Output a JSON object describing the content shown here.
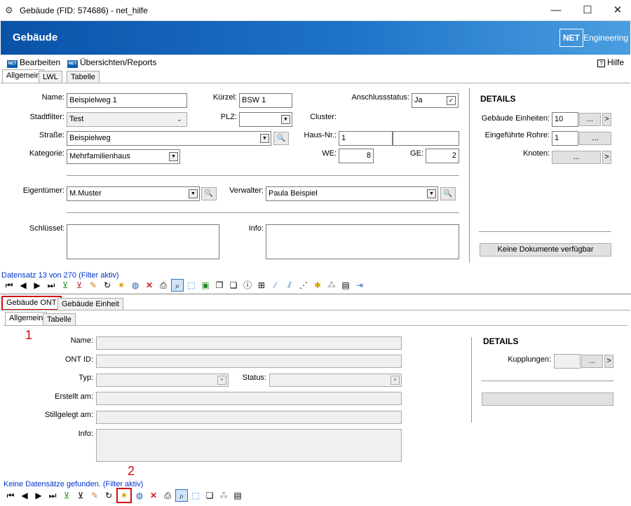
{
  "window": {
    "title": "Gebäude (FID: 574686) - net_hilfe",
    "minimize": "—",
    "maximize": "☐",
    "close": "✕"
  },
  "banner": {
    "title": "Gebäude",
    "logo": "NET",
    "company": "Engineering"
  },
  "menu": {
    "edit": "Bearbeiten",
    "reports": "Übersichten/Reports",
    "help": "Hilfe"
  },
  "tabs": {
    "allgemein": "Allgemein",
    "lwl": "LWL",
    "tabelle": "Tabelle"
  },
  "form": {
    "name_label": "Name:",
    "name": "Beispielweg 1",
    "kuerzel_label": "Kürzel:",
    "kuerzel": "BSW 1",
    "anschluss_label": "Anschlussstatus:",
    "anschluss": "Ja",
    "stadtfilter_label": "Stadtfilter:",
    "stadtfilter": "Test",
    "plz_label": "PLZ:",
    "plz": "",
    "cluster_label": "Cluster:",
    "strasse_label": "Straße:",
    "strasse": "Beispielweg",
    "hausnr_label": "Haus-Nr.:",
    "hausnr": "1",
    "hausnr_zusatz": "",
    "kategorie_label": "Kategorie:",
    "kategorie": "Mehrfamilienhaus",
    "we_label": "WE:",
    "we": "8",
    "ge_label": "GE:",
    "ge": "2",
    "eigentuemer_label": "Eigentümer:",
    "eigentuemer": "M.Muster",
    "verwalter_label": "Verwalter:",
    "verwalter": "Paula Beispiel",
    "schluessel_label": "Schlüssel:",
    "info_label": "Info:"
  },
  "details": {
    "title": "DETAILS",
    "einheiten_label": "Gebäude Einheiten:",
    "einheiten": "10",
    "rohre_label": "Eingeführte Rohre:",
    "rohre": "1",
    "knoten_label": "Knoten:",
    "ellipsis": "...",
    "arrow": ">",
    "no_docs": "Keine Dokumente verfügbar"
  },
  "status_top": "Datensatz 13 von 270 (Filter aktiv)",
  "subtabs": {
    "ont": "Gebäude ONT",
    "einheit": "Gebäude Einheit",
    "allgemein": "Allgemein",
    "tabelle": "Tabelle"
  },
  "ont": {
    "name_label": "Name:",
    "ontid_label": "ONT ID:",
    "typ_label": "Typ:",
    "status_label": "Status:",
    "erstellt_label": "Erstellt am:",
    "stillgelegt_label": "Stillgelegt am:",
    "info_label": "Info:"
  },
  "ont_details": {
    "title": "DETAILS",
    "kupplungen_label": "Kupplungen:"
  },
  "status_bottom": "Keine Datensätze gefunden. (Filter aktiv)",
  "markers": {
    "one": "1",
    "two": "2"
  }
}
